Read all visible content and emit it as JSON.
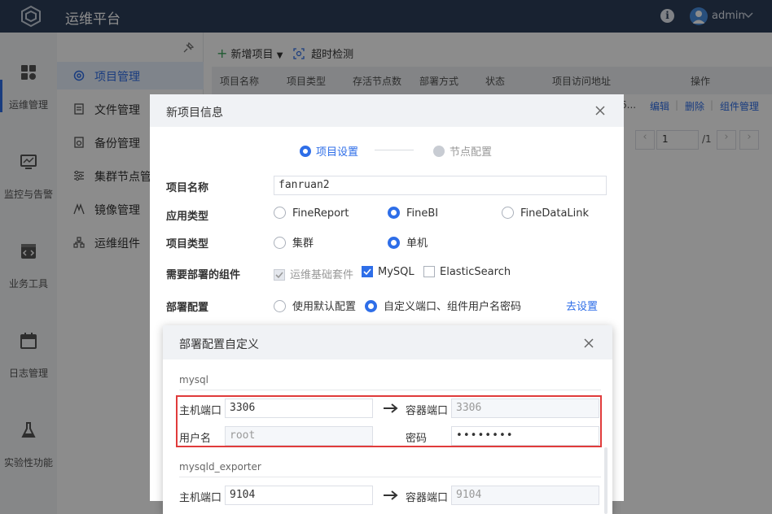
{
  "header": {
    "title": "运维平台",
    "user": "admin"
  },
  "leftnav": [
    {
      "label": "运维管理",
      "icon": "grid-icon",
      "active": true
    },
    {
      "label": "监控与告警",
      "icon": "monitor-icon"
    },
    {
      "label": "业务工具",
      "icon": "code-icon"
    },
    {
      "label": "日志管理",
      "icon": "calendar-icon"
    },
    {
      "label": "实验性功能",
      "icon": "flask-icon"
    }
  ],
  "subnav": [
    {
      "label": "项目管理",
      "icon": "settings-icon",
      "active": true
    },
    {
      "label": "文件管理",
      "icon": "file-icon"
    },
    {
      "label": "备份管理",
      "icon": "backup-icon"
    },
    {
      "label": "集群节点管",
      "icon": "sliders-icon"
    },
    {
      "label": "镜像管理",
      "icon": "image-icon"
    },
    {
      "label": "运维组件",
      "icon": "components-icon"
    }
  ],
  "toolbar": {
    "add_label": "新增项目",
    "timeout_label": "超时检测"
  },
  "table": {
    "headers": [
      "项目名称",
      "项目类型",
      "存活节点数",
      "部署方式",
      "状态",
      "项目访问地址",
      "操作"
    ],
    "row_partial": "6...",
    "actions": [
      "编辑",
      "删除",
      "组件管理"
    ],
    "separator": "|"
  },
  "pager": {
    "page": "1",
    "total": "/1",
    "prev": "‹",
    "next": "›"
  },
  "dialog1": {
    "title": "新项目信息",
    "steps": [
      "项目设置",
      "节点配置"
    ],
    "fields": {
      "project_name_label": "项目名称",
      "project_name_value": "fanruan2",
      "app_type_label": "应用类型",
      "app_type_options": [
        "FineReport",
        "FineBI",
        "FineDataLink"
      ],
      "project_type_label": "项目类型",
      "project_type_options": [
        "集群",
        "单机"
      ],
      "components_label": "需要部署的组件",
      "components": [
        "运维基础套件",
        "MySQL",
        "ElasticSearch"
      ],
      "deploy_label": "部署配置",
      "deploy_options": [
        "使用默认配置",
        "自定义端口、组件用户名密码"
      ],
      "deploy_link": "去设置"
    }
  },
  "dialog2": {
    "title": "部署配置自定义",
    "sections": [
      {
        "name": "mysql",
        "host_port_label": "主机端口",
        "host_port": "3306",
        "container_port_label": "容器端口",
        "container_port": "3306",
        "username_label": "用户名",
        "username": "root",
        "password_label": "密码",
        "password": "••••••••"
      },
      {
        "name": "mysqld_exporter",
        "host_port_label": "主机端口",
        "host_port": "9104",
        "container_port_label": "容器端口",
        "container_port": "9104"
      }
    ]
  },
  "colors": {
    "accent": "#2e6ee8",
    "topbar": "#2c3e5a",
    "highlight": "#e03b3b"
  }
}
